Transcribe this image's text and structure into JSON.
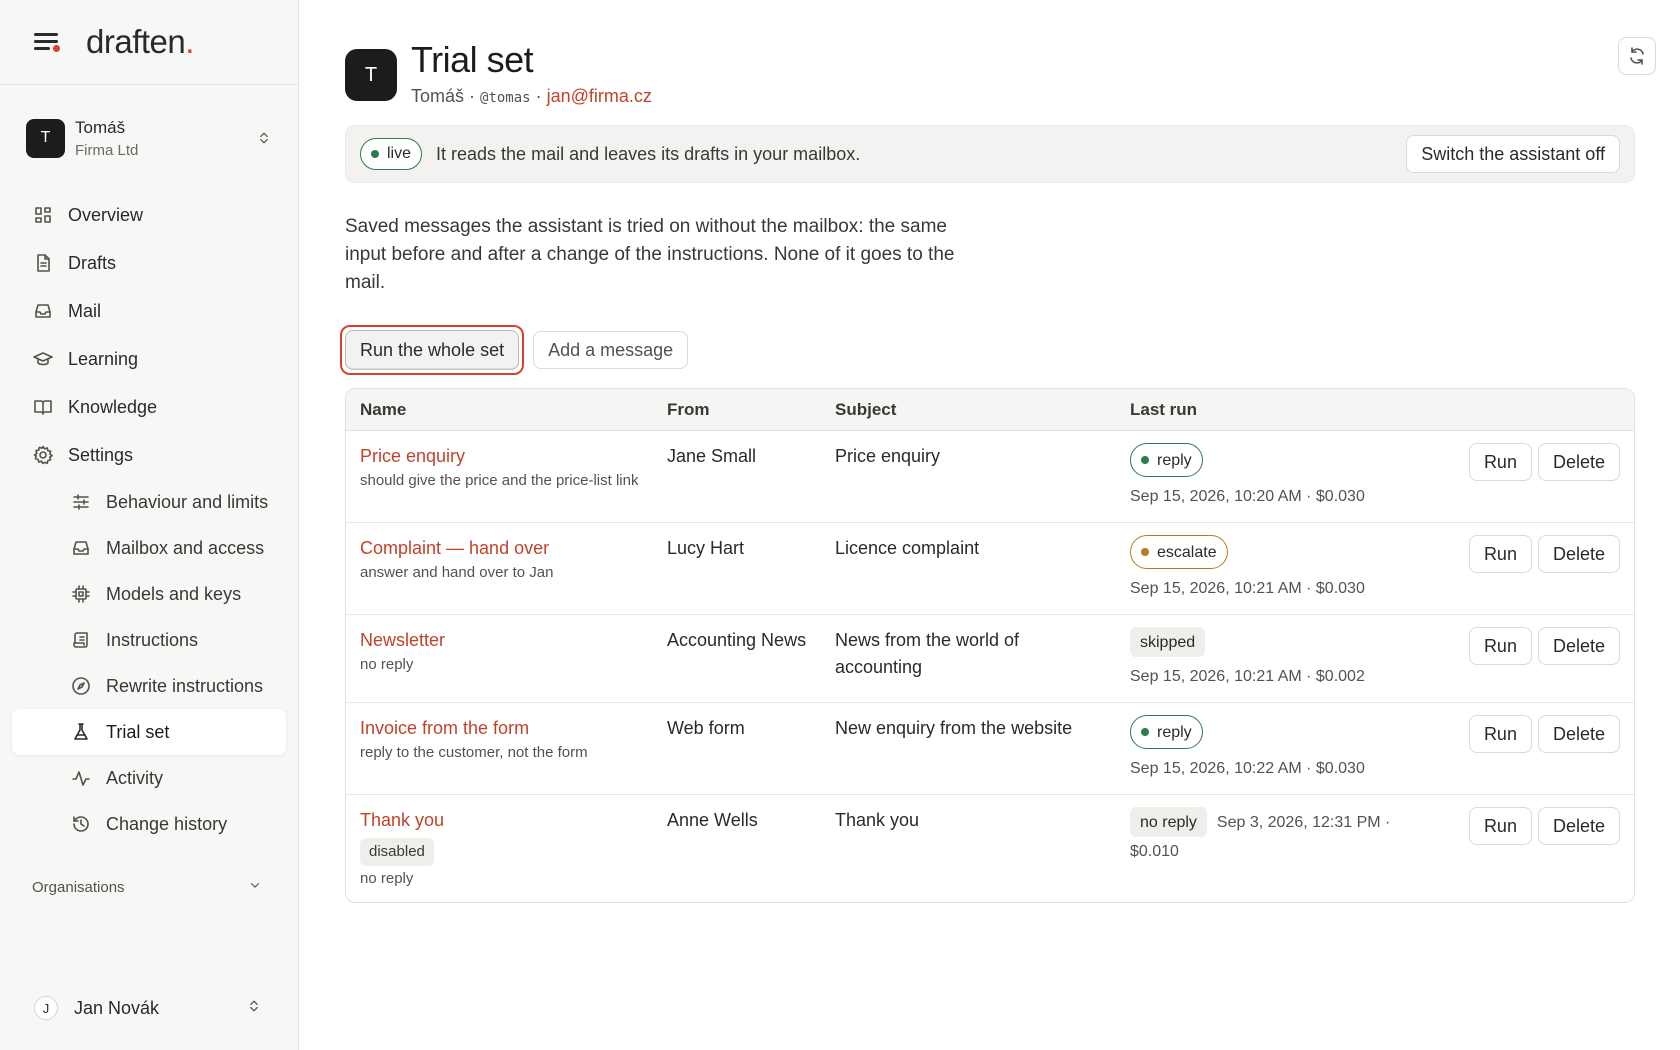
{
  "brand": {
    "name": "draften",
    "dot": "."
  },
  "account": {
    "initial": "T",
    "name": "Tomáš",
    "org": "Firma Ltd"
  },
  "nav": {
    "overview": "Overview",
    "drafts": "Drafts",
    "mail": "Mail",
    "learning": "Learning",
    "knowledge": "Knowledge",
    "settings": "Settings",
    "sub": {
      "behaviour": "Behaviour and limits",
      "mailbox": "Mailbox and access",
      "models": "Models and keys",
      "instructions": "Instructions",
      "rewrite": "Rewrite instructions",
      "trial": "Trial set",
      "activity": "Activity",
      "history": "Change history"
    },
    "organisations": "Organisations"
  },
  "user": {
    "initial": "J",
    "name": "Jan Novák"
  },
  "header": {
    "initial": "T",
    "title": "Trial set",
    "name": "Tomáš",
    "sep1": " · ",
    "handle": "@tomas",
    "sep2": " · ",
    "email": "jan@firma.cz"
  },
  "banner": {
    "status": "live",
    "text": "It reads the mail and leaves its drafts in your mailbox.",
    "switch_label": "Switch the assistant off"
  },
  "description": "Saved messages the assistant is tried on without the mailbox: the same input before and after a change of the instructions. None of it goes to the mail.",
  "actions": {
    "run_all": "Run the whole set",
    "add": "Add a message"
  },
  "table": {
    "headers": {
      "name": "Name",
      "from": "From",
      "subject": "Subject",
      "last_run": "Last run"
    },
    "run_label": "Run",
    "delete_label": "Delete",
    "rows": [
      {
        "name": "Price enquiry",
        "note": "should give the price and the price-list link",
        "from": "Jane Small",
        "subject": "Price enquiry",
        "result": "reply",
        "meta": "Sep 15, 2026, 10:20 AM · $0.030"
      },
      {
        "name": "Complaint — hand over",
        "note": "answer and hand over to Jan",
        "from": "Lucy Hart",
        "subject": "Licence complaint",
        "result": "escalate",
        "meta": "Sep 15, 2026, 10:21 AM · $0.030"
      },
      {
        "name": "Newsletter",
        "note": "no reply",
        "from": "Accounting News",
        "subject": "News from the world of accounting",
        "result": "skipped",
        "meta": "Sep 15, 2026, 10:21 AM · $0.002"
      },
      {
        "name": "Invoice from the form",
        "note": "reply to the customer, not the form",
        "from": "Web form",
        "subject": "New enquiry from the website",
        "result": "reply",
        "meta": "Sep 15, 2026, 10:22 AM · $0.030"
      },
      {
        "name": "Thank you",
        "tag": "disabled",
        "note": "no reply",
        "from": "Anne Wells",
        "subject": "Thank you",
        "result": "no reply",
        "meta": "Sep 3, 2026, 12:31 PM · $0.010"
      }
    ]
  },
  "colors": {
    "accent": "#c0432b",
    "live": "#2f7a4f",
    "escalate": "#b7791f"
  }
}
